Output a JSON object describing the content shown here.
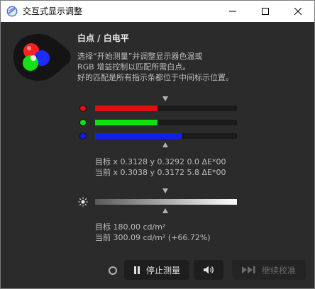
{
  "window": {
    "title": "交互式显示调整"
  },
  "panel": {
    "heading": "白点 / 白电平",
    "description": [
      "选择“开始测量”并调整显示器色温或",
      "RGB 增益控制以匹配所需白点。",
      "好的匹配是所有指示条都位于中间标示位置。"
    ]
  },
  "rgb_bars": [
    {
      "channel": "red",
      "color": "#e11010",
      "value_pct": 44
    },
    {
      "channel": "green",
      "color": "#10e010",
      "value_pct": 44
    },
    {
      "channel": "blue",
      "color": "#1020e8",
      "value_pct": 61
    }
  ],
  "whitepoint": {
    "target": "目标 x 0.3128 y 0.3292 0.0 ΔE*00",
    "current": "当前 x 0.3038 y 0.3172 5.8 ΔE*00"
  },
  "luminance": {
    "value_pct": 100,
    "target": "目标 180.00 cd/m²",
    "current": "当前 300.09 cd/m² (+66.72%)"
  },
  "buttons": {
    "pause_label": "停止测量",
    "continue_label": "继续校准"
  }
}
